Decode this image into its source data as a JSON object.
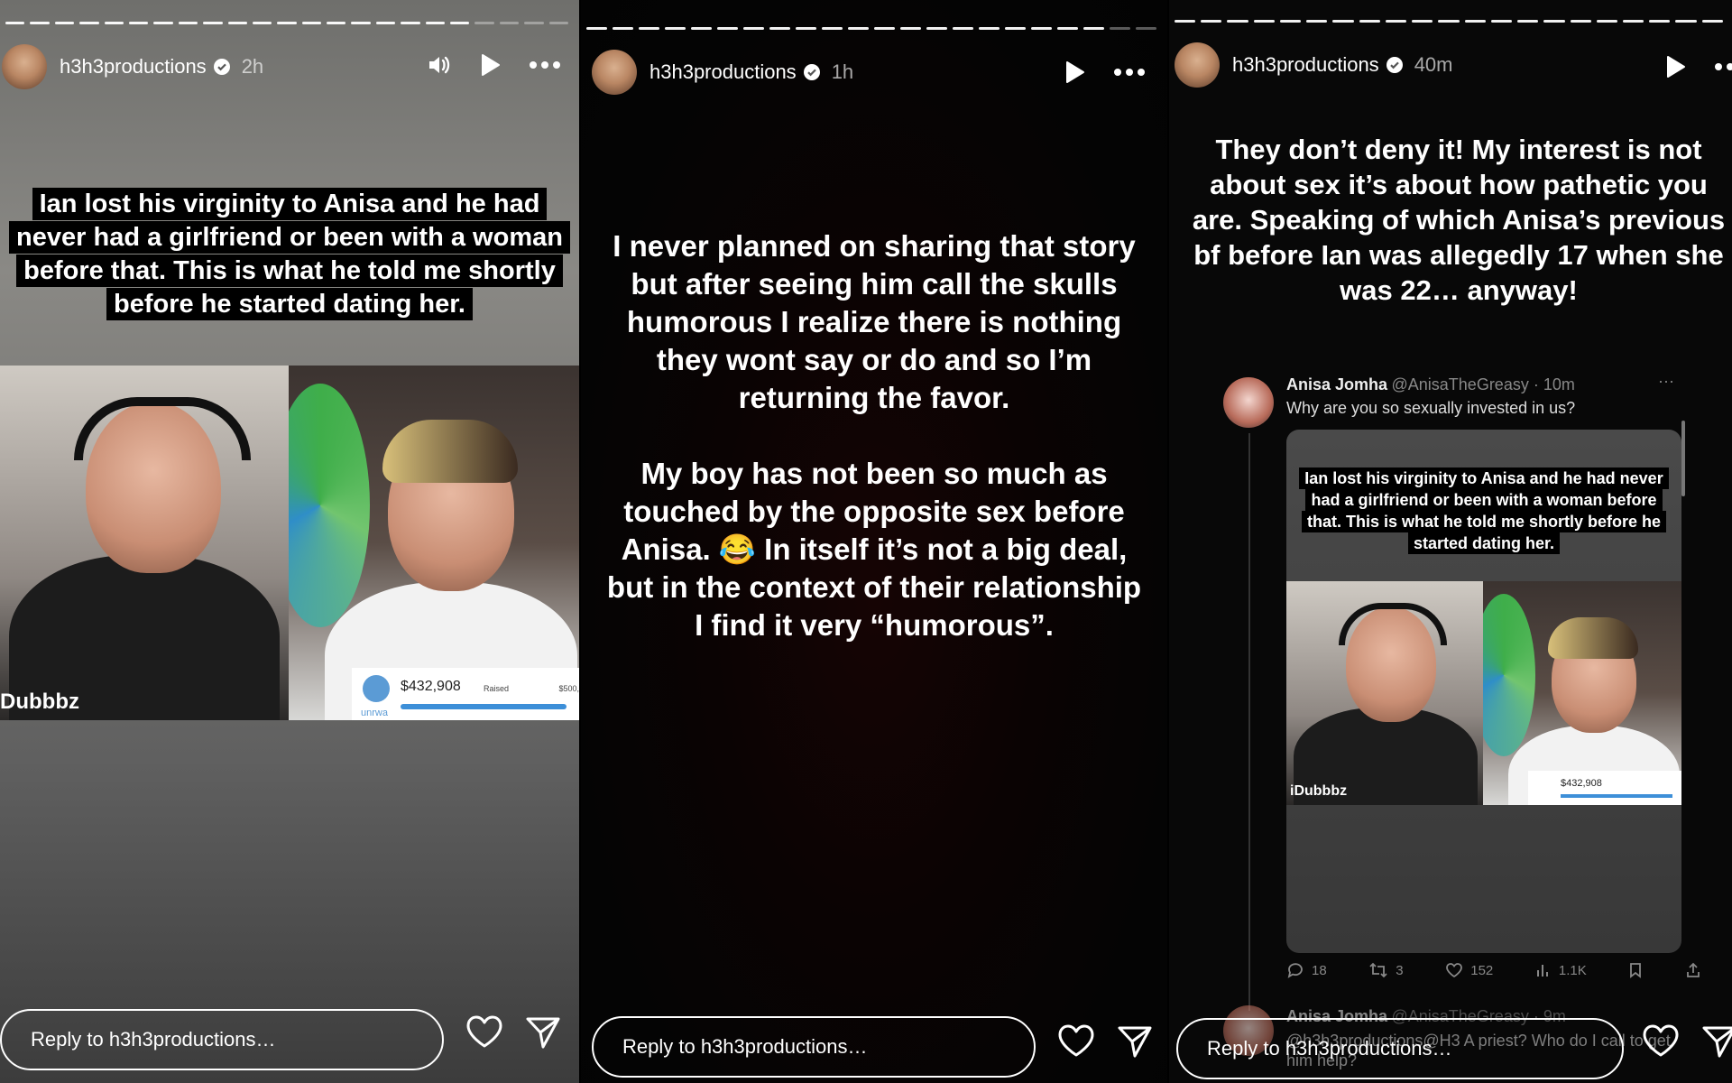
{
  "stories": [
    {
      "username": "h3h3productions",
      "time": "2h",
      "caption": "Ian lost his virginity to Anisa and he had never had a girlfriend or been with a woman before that. This is what he told me shortly before he started dating her.",
      "video_name": "Dubbbz",
      "donation_amount": "$432,908",
      "donation_label": "Raised",
      "donation_goal": "$500,",
      "donation_org": "unrwa",
      "reply_placeholder": "Reply to h3h3productions…"
    },
    {
      "username": "h3h3productions",
      "time": "1h",
      "caption_p1": "I never planned on sharing that story but after seeing him call the skulls humorous I realize there is nothing they wont say or do and so I’m returning the favor.",
      "caption_p2": "My boy has not been so much as touched by the opposite sex before Anisa. 😂 In itself it’s not a big deal, but in the context of their relationship I find it very “humorous”.",
      "reply_placeholder": "Reply to h3h3productions…"
    },
    {
      "username": "h3h3productions",
      "time": "40m",
      "caption": "They don’t deny it! My interest is not about sex it’s about how pathetic you are. Speaking of which Anisa’s previous bf before Ian was allegedly 17 when she was 22… anyway!",
      "tweet": {
        "name": "Anisa Jomha",
        "handle": "@AnisaTheGreasy · 10m",
        "text": "Why are you so sexually invested in us?",
        "media_caption": "Ian lost his virginity to Anisa and he had never had a girlfriend or been with a woman before that. This is what he told me shortly before he started dating her.",
        "media_video_name": "iDubbbz",
        "media_amount": "$432,908",
        "stats": {
          "replies": "18",
          "retweets": "3",
          "likes": "152",
          "views": "1.1K"
        }
      },
      "tweet2": {
        "name": "Anisa Jomha",
        "handle": "@AnisaTheGreasy · 9m",
        "text": "@h3h3productions@H3 A priest? Who do I call to get him help?"
      },
      "reply_placeholder": "Reply to h3h3productions…"
    }
  ],
  "colors": {
    "text": "#ffffff",
    "caption_bg": "#000000",
    "progress": "#ffffff"
  },
  "icons": [
    "volume-icon",
    "play-icon",
    "more-icon",
    "heart-icon",
    "send-icon",
    "verified-icon"
  ]
}
